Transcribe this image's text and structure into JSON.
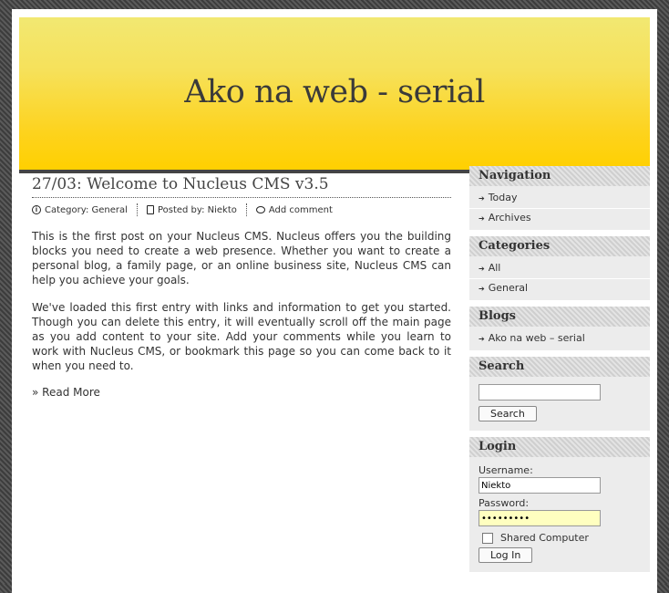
{
  "site": {
    "title": "Ako na web - serial"
  },
  "post": {
    "title": "27/03: Welcome to Nucleus CMS v3.5",
    "category_label": "Category:",
    "category": "General",
    "posted_by_label": "Posted by:",
    "author": "Niekto",
    "add_comment": "Add comment",
    "paragraphs": [
      "This is the first post on your Nucleus CMS. Nucleus offers you the building blocks you need to create a web presence. Whether you want to create a personal blog, a family page, or an online business site, Nucleus CMS can help you achieve your goals.",
      "We've loaded this first entry with links and information to get you started. Though you can delete this entry, it will eventually scroll off the main page as you add content to your site. Add your comments while you learn to work with Nucleus CMS, or bookmark this page so you can come back to it when you need to."
    ],
    "read_more": "» Read More"
  },
  "sidebar": {
    "navigation": {
      "title": "Navigation",
      "items": [
        "Today",
        "Archives"
      ]
    },
    "categories": {
      "title": "Categories",
      "items": [
        "All",
        "General"
      ]
    },
    "blogs": {
      "title": "Blogs",
      "items": [
        "Ako na web – serial"
      ]
    },
    "search": {
      "title": "Search",
      "value": "",
      "button": "Search"
    },
    "login": {
      "title": "Login",
      "username_label": "Username:",
      "username_value": "Niekto",
      "password_label": "Password:",
      "password_value": "•••••••••",
      "shared_label": "Shared Computer",
      "button": "Log In"
    }
  }
}
